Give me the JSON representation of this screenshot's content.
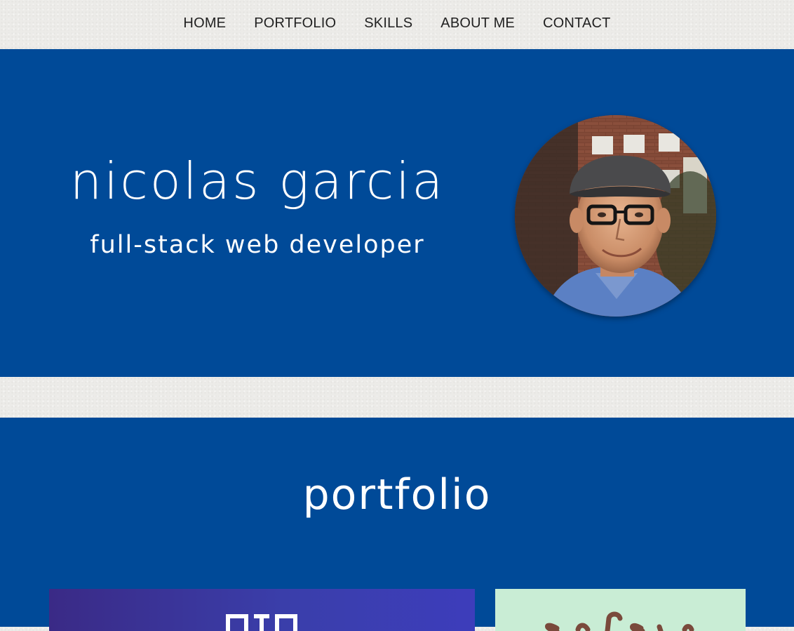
{
  "nav": {
    "items": [
      {
        "label": "HOME"
      },
      {
        "label": "PORTFOLIO"
      },
      {
        "label": "SKILLS"
      },
      {
        "label": "ABOUT ME"
      },
      {
        "label": "CONTACT"
      }
    ]
  },
  "hero": {
    "name": "nicolas garcia",
    "subtitle": "full-stack web developer",
    "avatar_icon": "profile-photo",
    "background_color": "#004a98"
  },
  "portfolio": {
    "title": "portfolio",
    "cards": [
      {
        "name": "portfolio-card-1",
        "background": "#3a3eaa"
      },
      {
        "name": "portfolio-card-2",
        "background": "#c9edd5"
      }
    ]
  },
  "colors": {
    "accent_blue": "#004a98",
    "paper": "#ecebe8",
    "nav_text": "#222222"
  }
}
